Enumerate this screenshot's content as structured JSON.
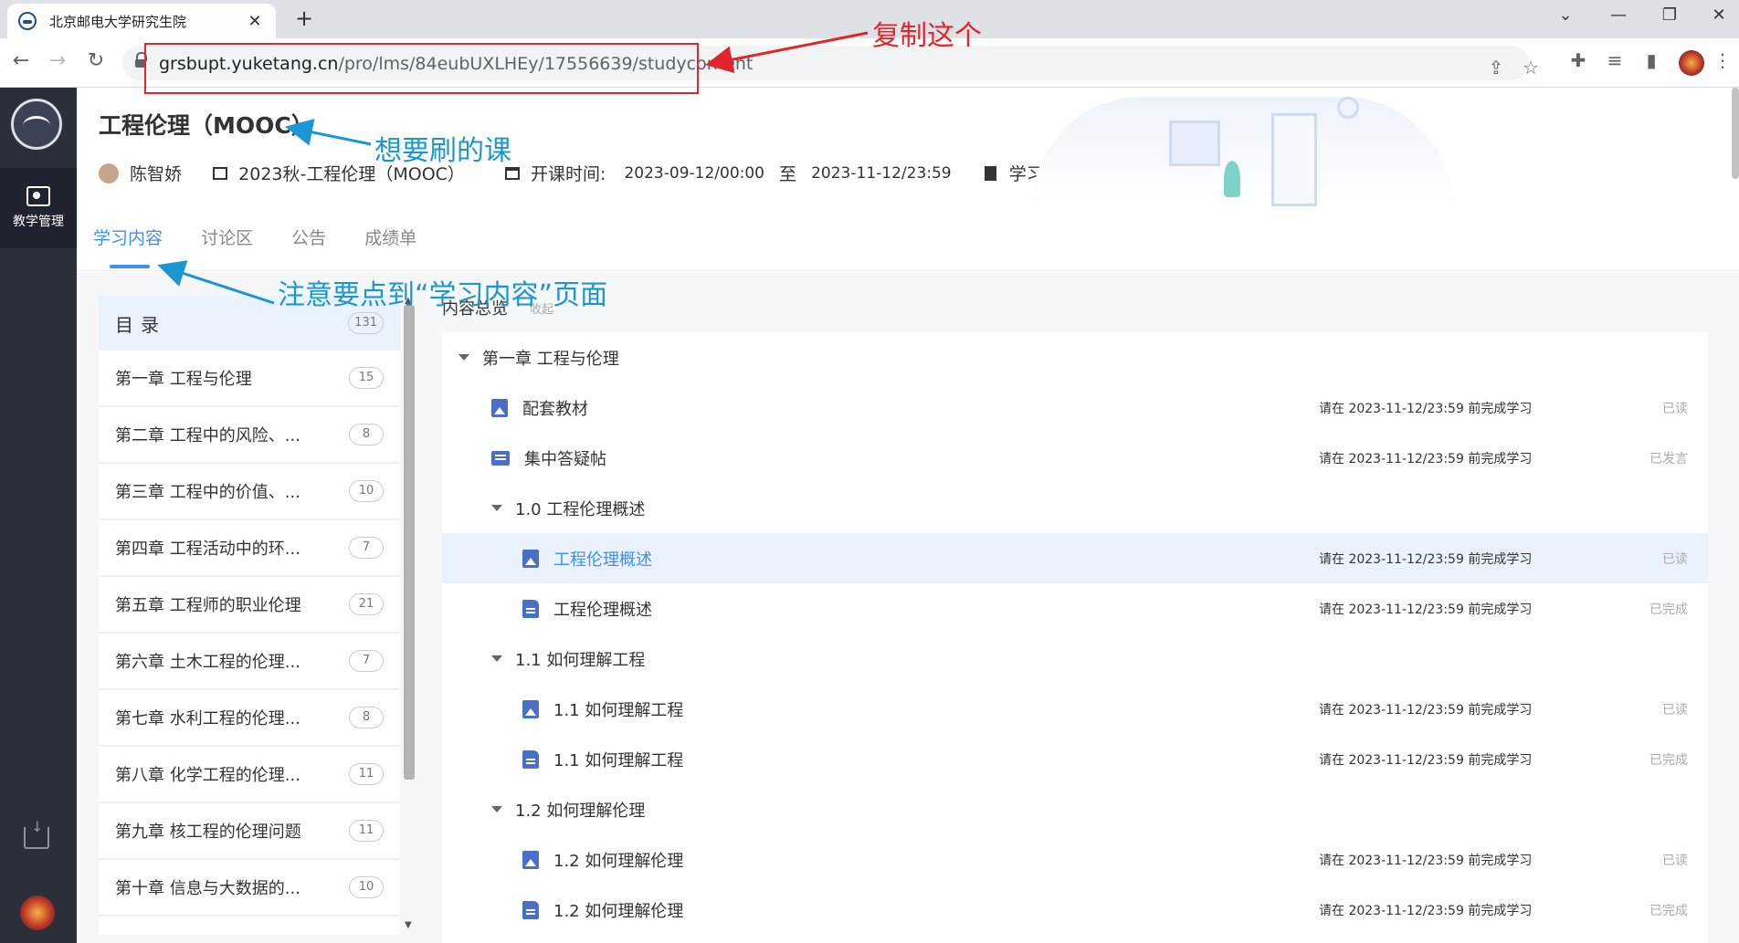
{
  "browser": {
    "tab_title": "北京邮电大学研究生院",
    "tab_close": "✕",
    "new_tab": "+",
    "url_domain": "grsbupt.yuketang.cn",
    "url_path": "/pro/lms/84eubUXLHEy/17556639/studycontent",
    "window_controls": [
      "⌄",
      "—",
      "❐",
      "✕"
    ],
    "nav": {
      "back": "←",
      "forward": "→",
      "reload": "↻"
    },
    "toolbar_icons": [
      "share-icon",
      "star-icon",
      "extensions-icon",
      "reading-list-icon",
      "side-panel-icon"
    ]
  },
  "rail": {
    "active_label": "教学管理"
  },
  "course": {
    "title": "工程伦理（MOOC）",
    "teacher": "陈智娇",
    "class_name": "2023秋-工程伦理（MOOC）",
    "time_label": "开课时间:",
    "time_start": "2023-09-12/00:00",
    "time_sep": "至",
    "time_end": "2023-11-12/23:59",
    "pledge": "学习承诺书"
  },
  "tabs": [
    "学习内容",
    "讨论区",
    "公告",
    "成绩单"
  ],
  "catalog": {
    "header": "目录",
    "header_count": "131",
    "items": [
      {
        "label": "第一章 工程与伦理",
        "count": "15"
      },
      {
        "label": "第二章 工程中的风险、...",
        "count": "8"
      },
      {
        "label": "第三章 工程中的价值、...",
        "count": "10"
      },
      {
        "label": "第四章 工程活动中的环...",
        "count": "7"
      },
      {
        "label": "第五章 工程师的职业伦理",
        "count": "21"
      },
      {
        "label": "第六章 土木工程的伦理...",
        "count": "7"
      },
      {
        "label": "第七章 水利工程的伦理...",
        "count": "8"
      },
      {
        "label": "第八章 化学工程的伦理...",
        "count": "11"
      },
      {
        "label": "第九章 核工程的伦理问题",
        "count": "11"
      },
      {
        "label": "第十章 信息与大数据的...",
        "count": "10"
      }
    ]
  },
  "overview": {
    "title": "内容总览",
    "collapse": "收起",
    "due_text": "请在 2023-11-12/23:59 前完成学习",
    "rows": [
      {
        "kind": "chapter",
        "label": "第一章 工程与伦理"
      },
      {
        "kind": "item",
        "icon": "img",
        "label": "配套教材",
        "status": "已读"
      },
      {
        "kind": "item",
        "icon": "chat",
        "label": "集中答疑帖",
        "status": "已发言"
      },
      {
        "kind": "section",
        "label": "1.0 工程伦理概述"
      },
      {
        "kind": "sub",
        "icon": "img",
        "label": "工程伦理概述",
        "status": "已读",
        "highlight": true
      },
      {
        "kind": "sub",
        "icon": "doc",
        "label": "工程伦理概述",
        "status": "已完成"
      },
      {
        "kind": "section",
        "label": "1.1 如何理解工程"
      },
      {
        "kind": "sub",
        "icon": "img",
        "label": "1.1 如何理解工程",
        "status": "已读"
      },
      {
        "kind": "sub",
        "icon": "doc",
        "label": "1.1 如何理解工程",
        "status": "已完成"
      },
      {
        "kind": "section",
        "label": "1.2 如何理解伦理"
      },
      {
        "kind": "sub",
        "icon": "img",
        "label": "1.2 如何理解伦理",
        "status": "已读"
      },
      {
        "kind": "sub",
        "icon": "doc",
        "label": "1.2 如何理解伦理",
        "status": "已完成"
      }
    ]
  },
  "annotations": {
    "copy": "复制这个",
    "course": "想要刷的课",
    "tab": "注意要点到“学习内容”页面",
    "red": "#e3242b",
    "blue": "#1a96d4"
  },
  "colors": {
    "accent": "#3c8ff5",
    "rail": "#2b2f3a"
  }
}
